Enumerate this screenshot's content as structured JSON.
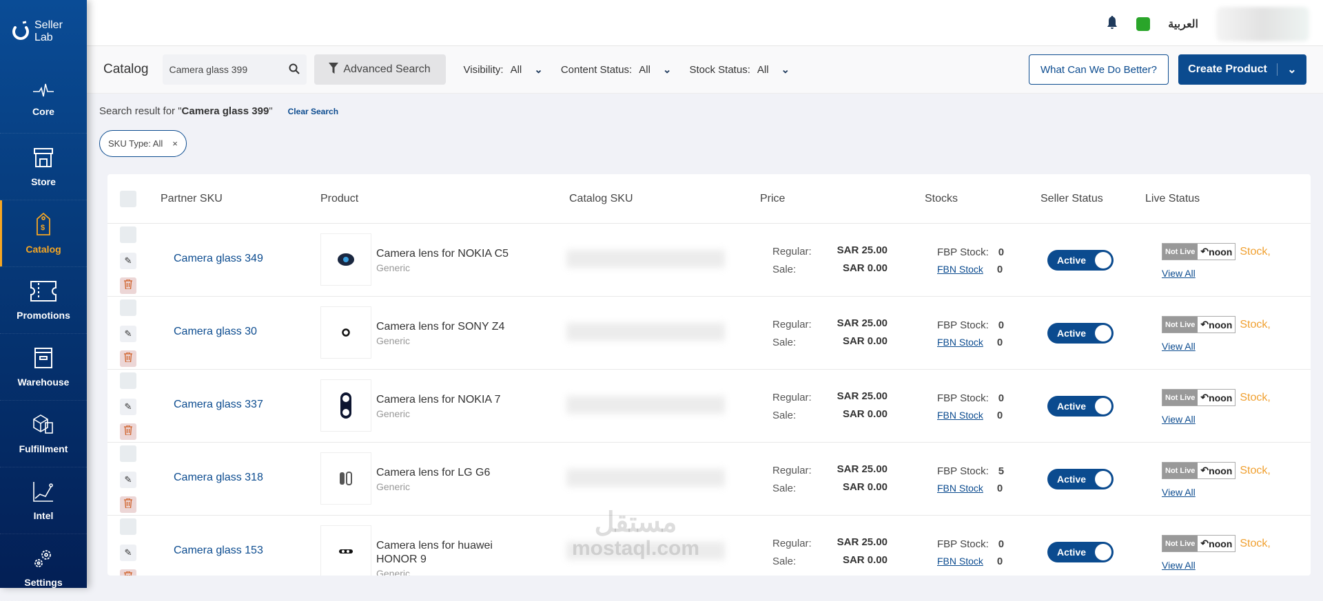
{
  "brand": {
    "line1": "Seller",
    "line2": "Lab"
  },
  "sidebar": {
    "items": [
      {
        "label": "Core",
        "icon": "pulse-icon"
      },
      {
        "label": "Store",
        "icon": "store-icon"
      },
      {
        "label": "Catalog",
        "icon": "price-tag-icon",
        "active": true
      },
      {
        "label": "Promotions",
        "icon": "ticket-icon"
      },
      {
        "label": "Warehouse",
        "icon": "archive-box-icon"
      },
      {
        "label": "Fulfillment",
        "icon": "package-icon"
      },
      {
        "label": "Intel",
        "icon": "line-chart-icon"
      },
      {
        "label": "Settings",
        "icon": "gears-icon"
      }
    ]
  },
  "topbar": {
    "language": "العربية"
  },
  "toolbar": {
    "title": "Catalog",
    "search_value": "Camera glass 399",
    "advanced_search": "Advanced Search",
    "filters": [
      {
        "label": "Visibility:",
        "value": "All"
      },
      {
        "label": "Content Status:",
        "value": "All"
      },
      {
        "label": "Stock Status:",
        "value": "All"
      }
    ],
    "feedback": "What Can We Do Better?",
    "create": "Create Product"
  },
  "search_result": {
    "prefix": "Search result for \"",
    "query": "Camera glass 399",
    "suffix": "\"",
    "clear": "Clear Search"
  },
  "chip": {
    "label": "SKU Type: All"
  },
  "table": {
    "headers": [
      "Partner SKU",
      "Product",
      "Catalog SKU",
      "Price",
      "Stocks",
      "Seller Status",
      "Live Status"
    ],
    "labels": {
      "regular": "Regular:",
      "sale": "Sale:",
      "fbp": "FBP Stock:",
      "fbn": "FBN Stock",
      "not_live": "Not Live",
      "noon": "noon",
      "stock": "Stock,",
      "view_all": "View All"
    },
    "rows": [
      {
        "sku": "Camera glass 349",
        "product": "Camera lens for NOKIA C5",
        "brand": "Generic",
        "regular": "SAR 25.00",
        "sale": "SAR 0.00",
        "fbp": "0",
        "fbn": "0",
        "status": "Active"
      },
      {
        "sku": "Camera glass 30",
        "product": "Camera lens for SONY Z4",
        "brand": "Generic",
        "regular": "SAR 25.00",
        "sale": "SAR 0.00",
        "fbp": "0",
        "fbn": "0",
        "status": "Active"
      },
      {
        "sku": "Camera glass 337",
        "product": "Camera lens for NOKIA 7",
        "brand": "Generic",
        "regular": "SAR 25.00",
        "sale": "SAR 0.00",
        "fbp": "0",
        "fbn": "0",
        "status": "Active"
      },
      {
        "sku": "Camera glass 318",
        "product": "Camera lens for LG G6",
        "brand": "Generic",
        "regular": "SAR 25.00",
        "sale": "SAR 0.00",
        "fbp": "5",
        "fbn": "0",
        "status": "Active"
      },
      {
        "sku": "Camera glass 153",
        "product": "Camera lens for huawei HONOR 9",
        "brand": "Generic",
        "regular": "SAR 25.00",
        "sale": "SAR 0.00",
        "fbp": "0",
        "fbn": "0",
        "status": "Active"
      }
    ]
  },
  "watermark": {
    "line1": "مستقل",
    "line2": "mostaql.com"
  },
  "colors": {
    "primary": "#0b4b8f",
    "accent": "#f5a623",
    "delete": "#d0622a"
  }
}
